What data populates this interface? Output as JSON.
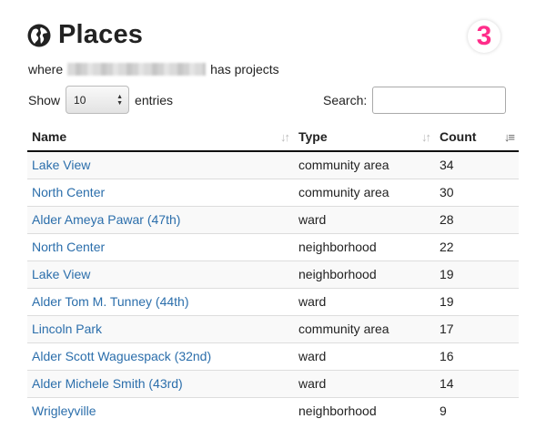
{
  "page": {
    "title": "Places",
    "badge": "3"
  },
  "subtitle": {
    "prefix": "where",
    "suffix": "has projects"
  },
  "length_control": {
    "show_label": "Show",
    "selected": "10",
    "entries_label": "entries"
  },
  "search": {
    "label": "Search:",
    "value": ""
  },
  "table": {
    "columns": [
      "Name",
      "Type",
      "Count"
    ],
    "sorted_column": "Count",
    "rows": [
      {
        "name": "Lake View",
        "type": "community area",
        "count": "34"
      },
      {
        "name": "North Center",
        "type": "community area",
        "count": "30"
      },
      {
        "name": "Alder Ameya Pawar (47th)",
        "type": "ward",
        "count": "28"
      },
      {
        "name": "North Center",
        "type": "neighborhood",
        "count": "22"
      },
      {
        "name": "Lake View",
        "type": "neighborhood",
        "count": "19"
      },
      {
        "name": "Alder Tom M. Tunney (44th)",
        "type": "ward",
        "count": "19"
      },
      {
        "name": "Lincoln Park",
        "type": "community area",
        "count": "17"
      },
      {
        "name": "Alder Scott Waguespack (32nd)",
        "type": "ward",
        "count": "16"
      },
      {
        "name": "Alder Michele Smith (43rd)",
        "type": "ward",
        "count": "14"
      },
      {
        "name": "Wrigleyville",
        "type": "neighborhood",
        "count": "9"
      }
    ]
  },
  "colors": {
    "link": "#2b6eab",
    "badge": "#ff2d8a"
  }
}
